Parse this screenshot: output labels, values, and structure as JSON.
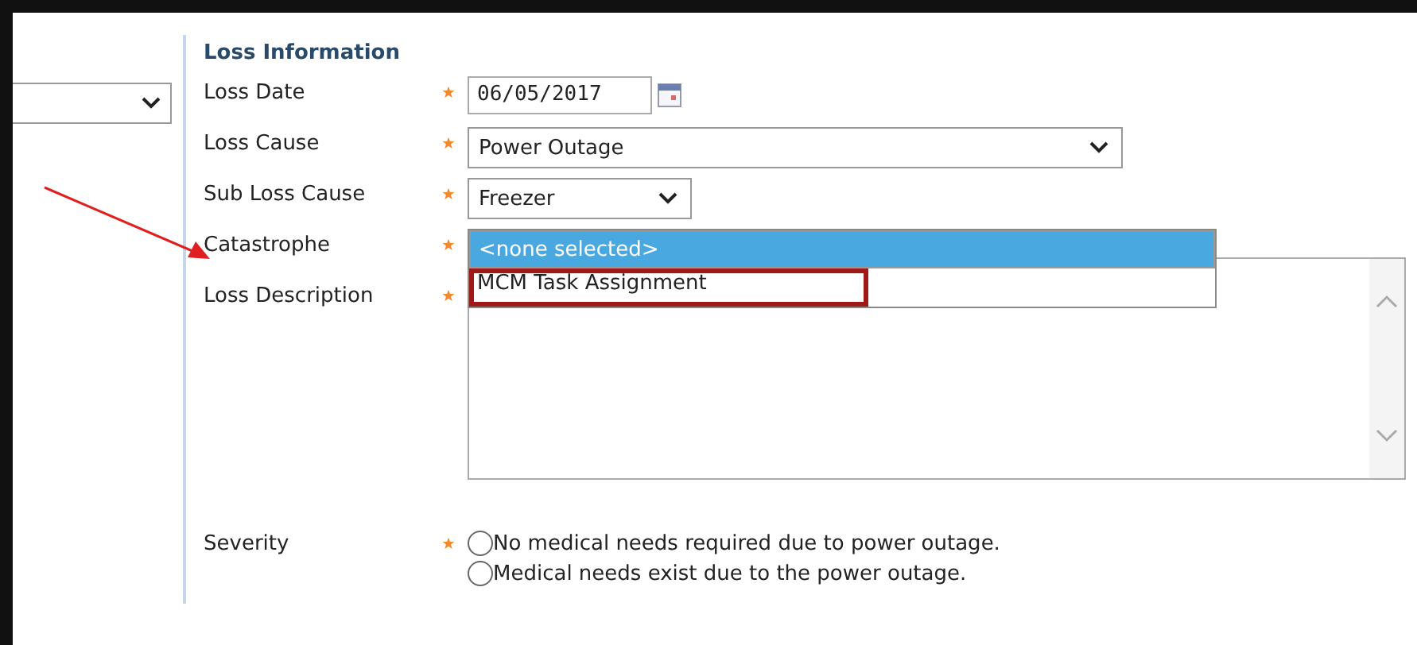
{
  "section_title": "Loss Information",
  "fields": [
    {
      "kind": "date",
      "label": "Loss Date",
      "required": true,
      "value": "06/05/2017"
    },
    {
      "kind": "select",
      "label": "Loss Cause",
      "required": true,
      "value": "Power Outage"
    },
    {
      "kind": "select-small",
      "label": "Sub Loss Cause",
      "required": true,
      "value": "Freezer"
    },
    {
      "kind": "open-list",
      "label": "Catastrophe",
      "required": true,
      "options": [
        {
          "label": "<none selected>",
          "selected": true,
          "highlighted": false
        },
        {
          "label": "MCM Task Assignment",
          "selected": false,
          "highlighted": true
        }
      ]
    },
    {
      "kind": "textarea",
      "label": "Loss Description",
      "required": true
    },
    {
      "kind": "radios",
      "label": "Severity",
      "required": true,
      "options": [
        {
          "label": "No medical needs required due to power outage.",
          "selected": false
        },
        {
          "label": "Medical needs exist due to the power outage.",
          "selected": false
        }
      ]
    }
  ],
  "annotations": [
    {
      "kind": "arrow"
    }
  ]
}
